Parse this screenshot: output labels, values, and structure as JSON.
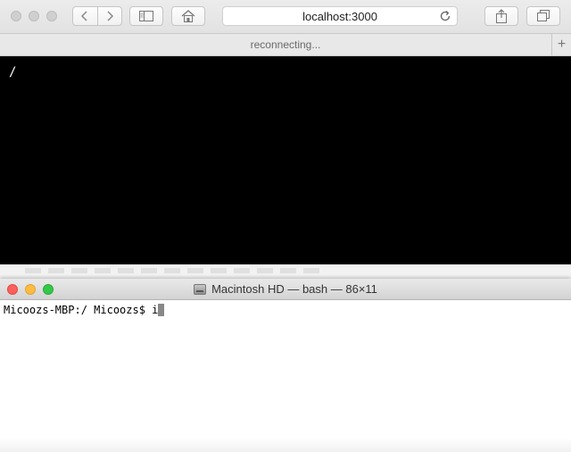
{
  "browser": {
    "address": "localhost:3000",
    "tab_status": "reconnecting...",
    "new_tab_label": "+",
    "page": {
      "prompt": "/"
    }
  },
  "terminal": {
    "title": "Macintosh HD — bash — 86×11",
    "prompt": "Micoozs-MBP:/ Micoozs$ ",
    "input": "i"
  },
  "icons": {
    "back": "chevron-left-icon",
    "forward": "chevron-right-icon",
    "sidebar": "sidebar-icon",
    "home": "home-icon",
    "reload": "reload-icon",
    "share": "share-icon",
    "tabs": "tabs-icon",
    "disk": "hard-disk-icon"
  },
  "colors": {
    "close": "#fc605c",
    "minimize": "#fdbc40",
    "zoom": "#34c84a",
    "page_background": "#000000"
  }
}
